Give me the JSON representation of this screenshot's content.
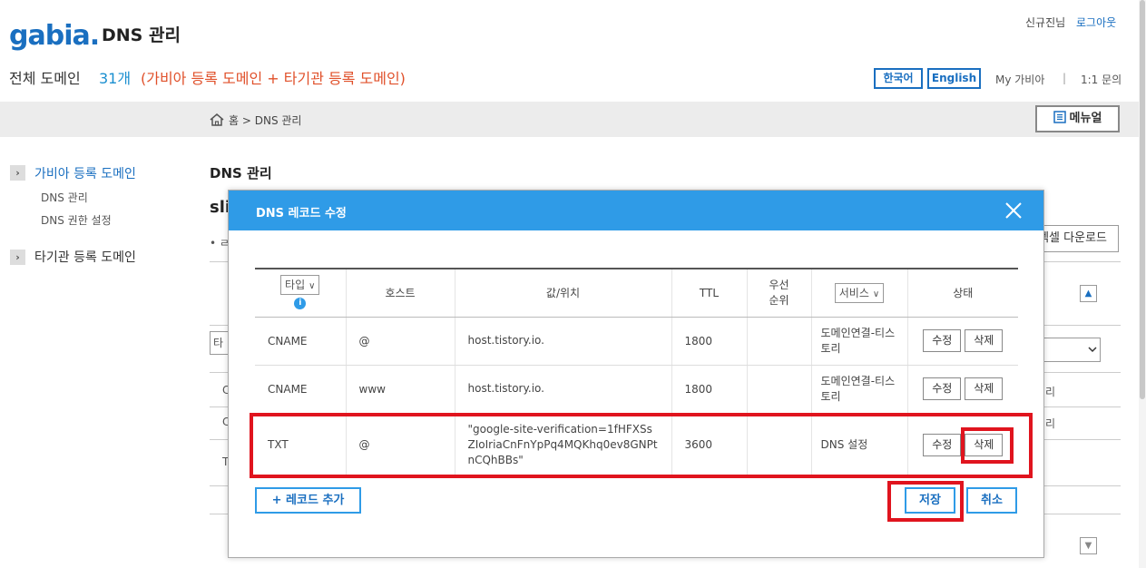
{
  "header": {
    "logo": "gabia.",
    "app_title": "DNS 관리",
    "user": "신규진님",
    "logout": "로그아웃",
    "domain_total_label": "전체 도메인",
    "domain_count": "31개",
    "domain_desc": "(가비아 등록 도메인 + 타기관 등록 도메인)",
    "lang_ko": "한국어",
    "lang_en": "English",
    "my_gabia": "My 가비아",
    "separator": "|",
    "qna": "1:1 문의"
  },
  "breadcrumb": {
    "icon": "home-icon",
    "text": "홈 > DNS 관리",
    "manual": "메뉴얼"
  },
  "sidebar": {
    "groups": [
      {
        "label": "가비아 등록 도메인",
        "items": [
          "DNS 관리",
          "DNS 권한 설정"
        ]
      },
      {
        "label": "타기관 등록 도메인",
        "items": []
      }
    ]
  },
  "background": {
    "title": "DNS 관리",
    "domain_prefix": "sli",
    "bullet": "• ㄹ",
    "excel": "엑셀 다운로드",
    "input_prefix": "타",
    "row_prefixes": [
      "C",
      "C",
      "T"
    ],
    "row_suffixes": [
      "리",
      "리"
    ]
  },
  "modal": {
    "title": "DNS 레코드 수정",
    "columns": {
      "type": "타입",
      "host": "호스트",
      "value": "값/위치",
      "ttl": "TTL",
      "priority": "우선 순위",
      "service": "서비스",
      "state": "상태"
    },
    "rows": [
      {
        "type": "CNAME",
        "host": "@",
        "value": "host.tistory.io.",
        "ttl": "1800",
        "priority": "",
        "service": "도메인연결-티스토리",
        "edit": "수정",
        "delete": "삭제"
      },
      {
        "type": "CNAME",
        "host": "www",
        "value": "host.tistory.io.",
        "ttl": "1800",
        "priority": "",
        "service": "도메인연결-티스토리",
        "edit": "수정",
        "delete": "삭제"
      },
      {
        "type": "TXT",
        "host": "@",
        "value": "\"google-site-verification=1fHFXSsZIoIriaCnFnYpPq4MQKhq0ev8GNPtnCQhBBs\"",
        "ttl": "3600",
        "priority": "",
        "service": "DNS 설정",
        "edit": "수정",
        "delete": "삭제"
      }
    ],
    "add_record": "+ 레코드 추가",
    "save": "저장",
    "cancel": "취소"
  },
  "colors": {
    "accent": "#2f9be7",
    "brand": "#1a6fc0",
    "highlight": "#e0141e",
    "warning_text": "#e0502a"
  }
}
